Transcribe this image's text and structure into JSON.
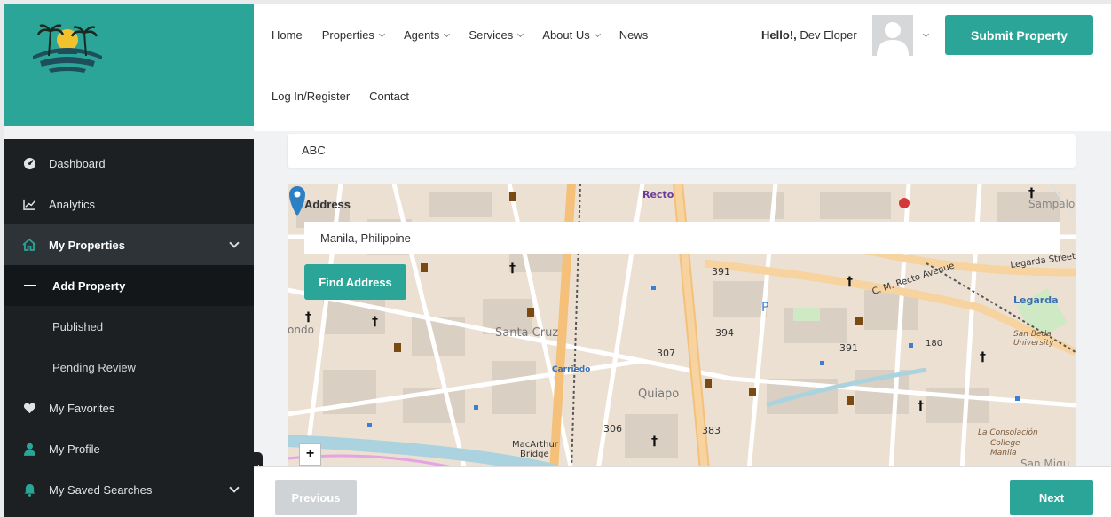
{
  "brand": {
    "accent": "#2aa597",
    "sidebar_bg": "#1d2023"
  },
  "header": {
    "nav": [
      {
        "label": "Home",
        "dropdown": false
      },
      {
        "label": "Properties",
        "dropdown": true
      },
      {
        "label": "Agents",
        "dropdown": true
      },
      {
        "label": "Services",
        "dropdown": true
      },
      {
        "label": "About Us",
        "dropdown": true
      },
      {
        "label": "News",
        "dropdown": false
      }
    ],
    "nav2": [
      "Log In/Register",
      "Contact"
    ],
    "greeting_bold": "Hello!,",
    "user_name": "Dev Eloper",
    "submit_label": "Submit Property"
  },
  "sidebar": {
    "items": [
      {
        "label": "Dashboard",
        "icon": "dashboard-icon"
      },
      {
        "label": "Analytics",
        "icon": "chart-icon"
      },
      {
        "label": "My Properties",
        "icon": "home-icon"
      },
      {
        "label": "Add Property"
      },
      {
        "label": "Published"
      },
      {
        "label": "Pending Review"
      },
      {
        "label": "My Favorites",
        "icon": "heart-icon"
      },
      {
        "label": "My Profile",
        "icon": "user-icon"
      },
      {
        "label": "My Saved Searches",
        "icon": "bell-icon"
      }
    ]
  },
  "form": {
    "top_field_value": "ABC",
    "address_label": "Address",
    "address_value": "Manila, Philippine",
    "find_label": "Find Address",
    "zoom_in": "+"
  },
  "map_labels": {
    "recto": "Recto",
    "sampaloc": "Sampaloc",
    "legarda": "Legarda",
    "legarda_street": "Legarda Street",
    "santa_cruz": "Santa Cruz",
    "carriedo": "Carriedo",
    "quiapo": "Quiapo",
    "macarthur": "MacArthur",
    "bridge": "Bridge",
    "san_beda": "San Beda",
    "university": "University",
    "la_consolacion": "La Consolación",
    "college": "College",
    "manila": "Manila",
    "san_miguel": "San Migu",
    "ondo": "ondo",
    "c_m_recto": "C. M. Recto Avenue",
    "road_391a": "391",
    "road_391b": "391",
    "road_394": "394",
    "road_307": "307",
    "road_306": "306",
    "road_383": "383",
    "road_180": "180",
    "parking": "P"
  },
  "footer": {
    "previous_label": "Previous",
    "next_label": "Next"
  }
}
